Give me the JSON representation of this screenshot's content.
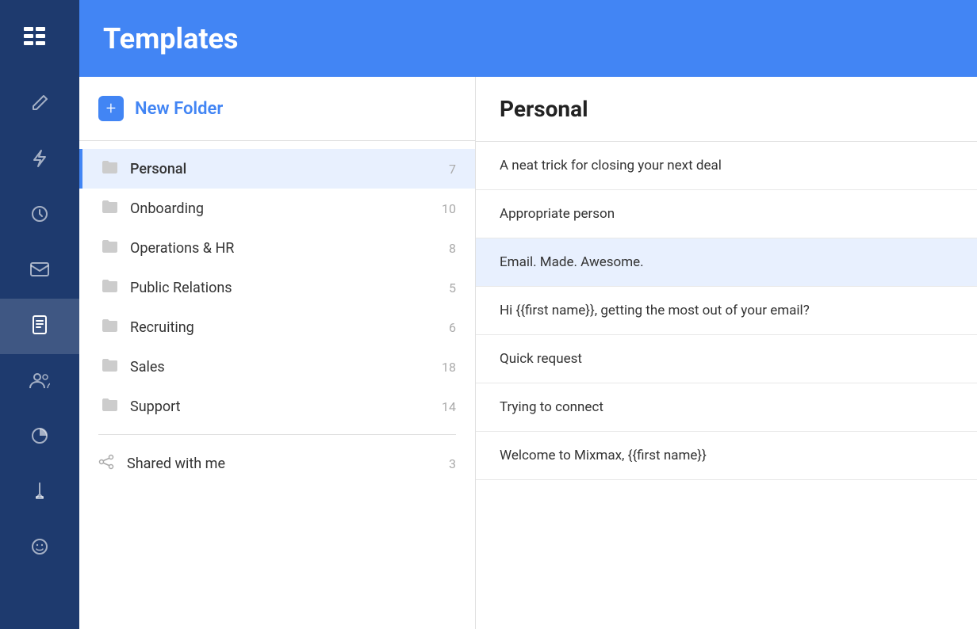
{
  "header": {
    "title": "Templates"
  },
  "sidebar": {
    "logo": "≡≡",
    "items": [
      {
        "id": "compose",
        "icon": "✏️",
        "active": false
      },
      {
        "id": "lightning",
        "icon": "⚡",
        "active": false
      },
      {
        "id": "clock",
        "icon": "🕐",
        "active": false
      },
      {
        "id": "mail",
        "icon": "✉️",
        "active": false
      },
      {
        "id": "templates",
        "icon": "📄",
        "active": true
      },
      {
        "id": "people",
        "icon": "👥",
        "active": false
      },
      {
        "id": "chart",
        "icon": "📊",
        "active": false
      },
      {
        "id": "pencil",
        "icon": "✎",
        "active": false
      },
      {
        "id": "emoji",
        "icon": "😊",
        "active": false
      }
    ]
  },
  "folder_panel": {
    "new_folder_label": "New Folder",
    "new_folder_icon": "+",
    "folders": [
      {
        "id": "personal",
        "name": "Personal",
        "count": "7",
        "active": true
      },
      {
        "id": "onboarding",
        "name": "Onboarding",
        "count": "10",
        "active": false
      },
      {
        "id": "operations-hr",
        "name": "Operations & HR",
        "count": "8",
        "active": false
      },
      {
        "id": "public-relations",
        "name": "Public Relations",
        "count": "5",
        "active": false
      },
      {
        "id": "recruiting",
        "name": "Recruiting",
        "count": "6",
        "active": false
      },
      {
        "id": "sales",
        "name": "Sales",
        "count": "18",
        "active": false
      },
      {
        "id": "support",
        "name": "Support",
        "count": "14",
        "active": false
      }
    ],
    "shared": {
      "name": "Shared with me",
      "count": "3"
    }
  },
  "templates_panel": {
    "title": "Personal",
    "items": [
      {
        "id": "t1",
        "name": "A neat trick for closing your next deal",
        "highlighted": false
      },
      {
        "id": "t2",
        "name": "Appropriate person",
        "highlighted": false
      },
      {
        "id": "t3",
        "name": "Email. Made. Awesome.",
        "highlighted": true
      },
      {
        "id": "t4",
        "name": "Hi {{first name}}, getting the most out of your email?",
        "highlighted": false
      },
      {
        "id": "t5",
        "name": "Quick request",
        "highlighted": false
      },
      {
        "id": "t6",
        "name": "Trying to connect",
        "highlighted": false
      },
      {
        "id": "t7",
        "name": "Welcome to Mixmax, {{first name}}",
        "highlighted": false
      }
    ]
  },
  "icons": {
    "folder": "🗂",
    "share": "🔗"
  }
}
